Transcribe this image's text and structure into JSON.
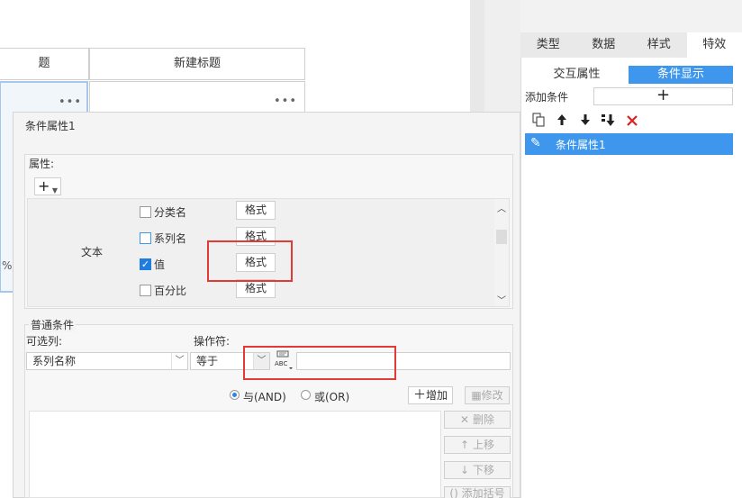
{
  "canvas": {
    "header_cells": [
      "题",
      "新建标题"
    ],
    "cell_more": "•••",
    "partial_label": "%"
  },
  "right_panel": {
    "tabs": [
      "类型",
      "数据",
      "样式",
      "特效"
    ],
    "active_tab": "特效",
    "subtabs": [
      "交互属性",
      "条件显示"
    ],
    "active_subtab": "条件显示",
    "add_condition_label": "添加条件",
    "add_button": "+",
    "list": [
      {
        "label": "条件属性1",
        "selected": true
      }
    ]
  },
  "dialog": {
    "title": "条件属性1",
    "properties": {
      "legend": "属性:",
      "add_button": "+",
      "group_label": "文本",
      "items": [
        {
          "label": "分类名",
          "checked": false,
          "format_button": "格式"
        },
        {
          "label": "系列名",
          "checked": false,
          "format_button": "格式"
        },
        {
          "label": "值",
          "checked": true,
          "format_button": "格式"
        },
        {
          "label": "百分比",
          "checked": false,
          "format_button": "格式"
        }
      ]
    },
    "conditions": {
      "legend": "普通条件",
      "column_label": "可选列:",
      "column_value": "系列名称",
      "operator_label": "操作符:",
      "operator_value": "等于",
      "value_input": "",
      "radio_and": "与(AND)",
      "radio_or": "或(OR)",
      "selected_logic": "and",
      "add_button": "增加",
      "modify_button": "修改",
      "delete_button": "删除",
      "up_button": "上移",
      "down_button": "下移",
      "bracket_button": "添加括号"
    }
  },
  "colors": {
    "accent": "#3e97ec",
    "highlight_box": "#e53935"
  }
}
